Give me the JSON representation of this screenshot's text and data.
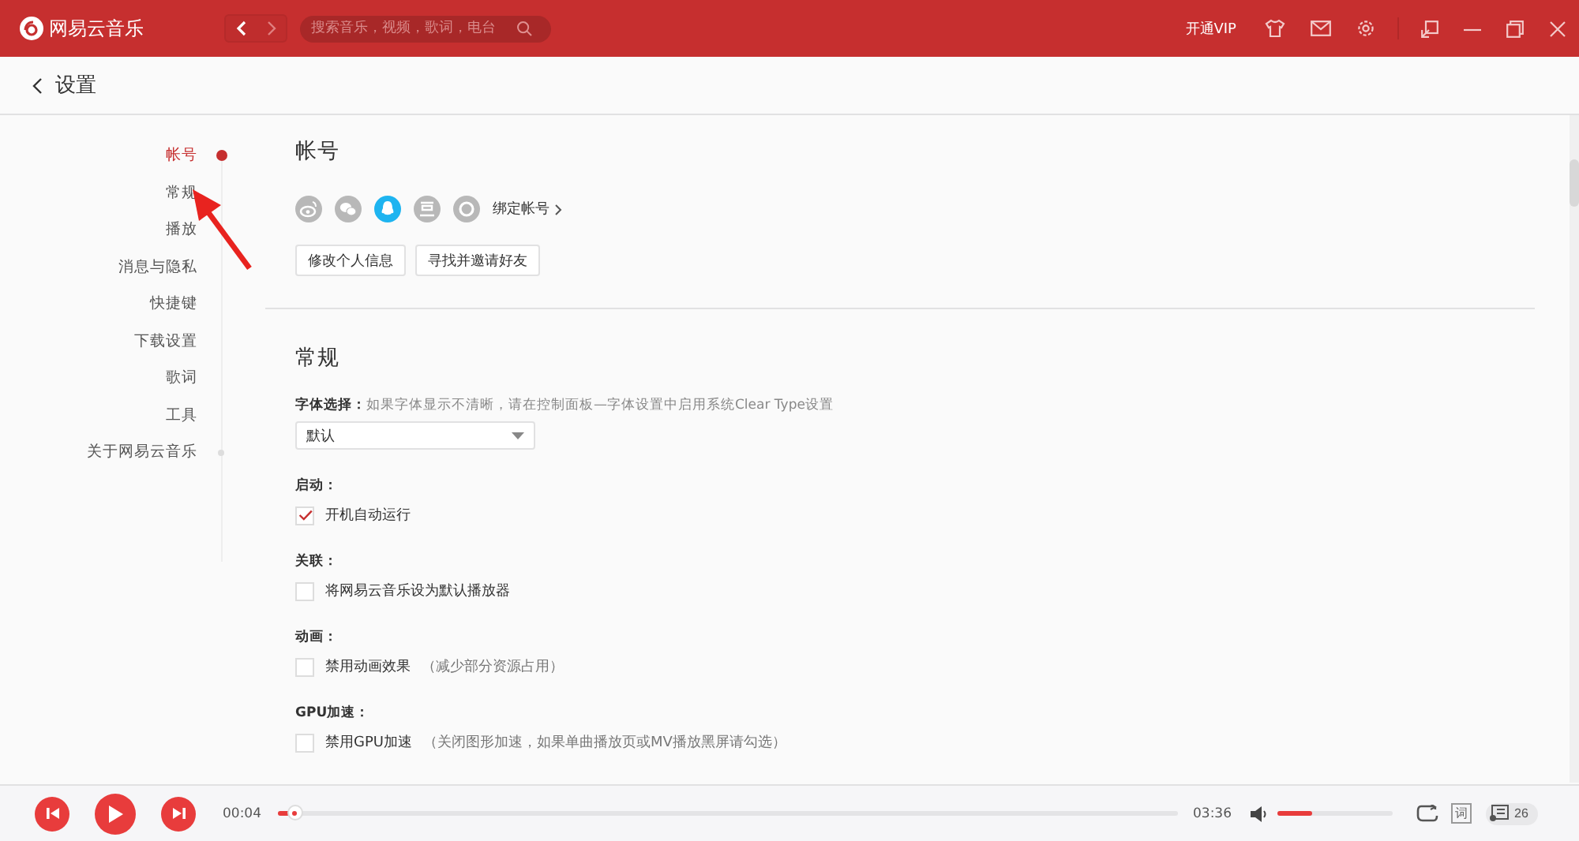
{
  "topbar": {
    "logo_text": "网易云音乐",
    "search": {
      "placeholder": "搜索音乐，视频，歌词，电台"
    },
    "vip": "开通VIP"
  },
  "page": {
    "title": "设置"
  },
  "nav": [
    {
      "label": "帐号",
      "selected": true
    },
    {
      "label": "常规",
      "selected": false
    },
    {
      "label": "播放",
      "selected": false
    },
    {
      "label": "消息与隐私",
      "selected": false
    },
    {
      "label": "快捷键",
      "selected": false
    },
    {
      "label": "下载设置",
      "selected": false
    },
    {
      "label": "歌词",
      "selected": false
    },
    {
      "label": "工具",
      "selected": false
    },
    {
      "label": "关于网易云音乐",
      "selected": false
    }
  ],
  "account": {
    "title": "帐号",
    "accounts": [
      {
        "kind": "weibo",
        "bound": false
      },
      {
        "kind": "wechat",
        "bound": false
      },
      {
        "kind": "qq",
        "bound": true
      },
      {
        "kind": "douban",
        "bound": false
      },
      {
        "kind": "yixin",
        "bound": false
      }
    ],
    "bind_label": "绑定帐号",
    "buttons": [
      "修改个人信息",
      "寻找并邀请好友"
    ]
  },
  "general": {
    "title": "常规",
    "font": {
      "label": "字体选择：",
      "hint": "如果字体显示不清晰，请在控制面板—字体设置中启用系统Clear Type设置",
      "value": "默认"
    },
    "groups": [
      {
        "label": "启动：",
        "option": "开机自动运行",
        "checked": true
      },
      {
        "label": "关联：",
        "option": "将网易云音乐设为默认播放器",
        "checked": false
      },
      {
        "label": "动画：",
        "option": "禁用动画效果",
        "note": "（减少部分资源占用）",
        "checked": false
      },
      {
        "label": "GPU加速：",
        "option": "禁用GPU加速",
        "note": "（关闭图形加速，如果单曲播放页或MV播放黑屏请勾选）",
        "checked": false
      }
    ]
  },
  "player": {
    "elapsed": "00:04",
    "duration": "03:36",
    "progress": {
      "level": 0.02
    },
    "volume": {
      "level": 0.3
    },
    "lyrics": "词",
    "playlist_count": "26"
  }
}
